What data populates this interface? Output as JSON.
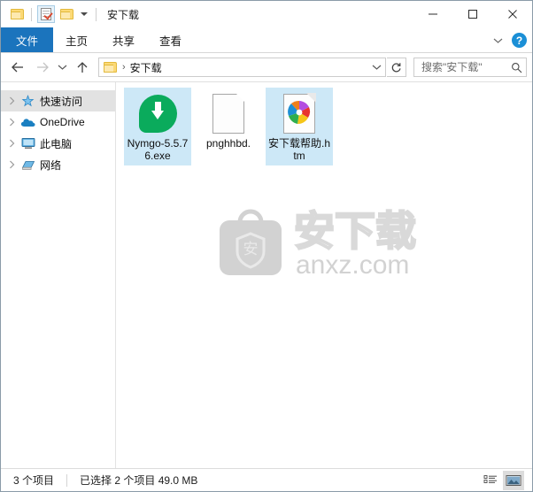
{
  "window": {
    "title": "安下载",
    "quick_access": {
      "folder_icon": "folder-icon",
      "properties_icon": "properties-document-check-icon",
      "new_folder_icon": "new-folder-icon",
      "customize_icon": "chevron-down-icon"
    },
    "controls": {
      "minimize": "minimize-icon",
      "maximize": "maximize-icon",
      "close": "close-icon"
    }
  },
  "ribbon": {
    "tabs": [
      {
        "label": "文件",
        "active": true
      },
      {
        "label": "主页",
        "active": false
      },
      {
        "label": "共享",
        "active": false
      },
      {
        "label": "查看",
        "active": false
      }
    ],
    "expand_icon": "chevron-down-icon",
    "help_label": "?"
  },
  "addressbar": {
    "back_icon": "arrow-left-icon",
    "forward_icon": "arrow-right-icon",
    "recent_icon": "chevron-down-icon",
    "up_icon": "arrow-up-icon",
    "breadcrumb": {
      "folder_icon": "folder-icon",
      "separator": "›",
      "path": "安下载"
    },
    "dropdown_icon": "chevron-down-icon",
    "refresh_icon": "refresh-icon"
  },
  "search": {
    "placeholder": "搜索\"安下载\"",
    "value": "",
    "icon": "search-icon"
  },
  "navpane": {
    "items": [
      {
        "label": "快速访问",
        "icon": "star-pin-icon",
        "selected": true
      },
      {
        "label": "OneDrive",
        "icon": "onedrive-cloud-icon",
        "selected": false
      },
      {
        "label": "此电脑",
        "icon": "this-pc-monitor-icon",
        "selected": false
      },
      {
        "label": "网络",
        "icon": "network-icon",
        "selected": false
      }
    ]
  },
  "files": [
    {
      "name": "Nymgo-5.5.76.exe",
      "icon": "green-download-bubble-icon",
      "selected": true
    },
    {
      "name": "pnghhbd.",
      "icon": "blank-document-icon",
      "selected": false
    },
    {
      "name": "安下载帮助.htm",
      "icon": "html-pinwheel-document-icon",
      "selected": true
    }
  ],
  "watermark": {
    "logo_char": "安",
    "brand": "安下载",
    "domain": "anxz.com",
    "color": "#d2d2d2"
  },
  "statusbar": {
    "item_count": "3 个项目",
    "selection": "已选择 2 个项目  49.0 MB",
    "views": [
      {
        "name": "details-view-button",
        "active": false
      },
      {
        "name": "large-icons-view-button",
        "active": true
      }
    ]
  },
  "colors": {
    "accent": "#1b74bd",
    "selection": "#cde8f7",
    "nav_selection": "#e2e2e2",
    "folder_yellow": "#fcd976",
    "download_green": "#0aab5c"
  }
}
